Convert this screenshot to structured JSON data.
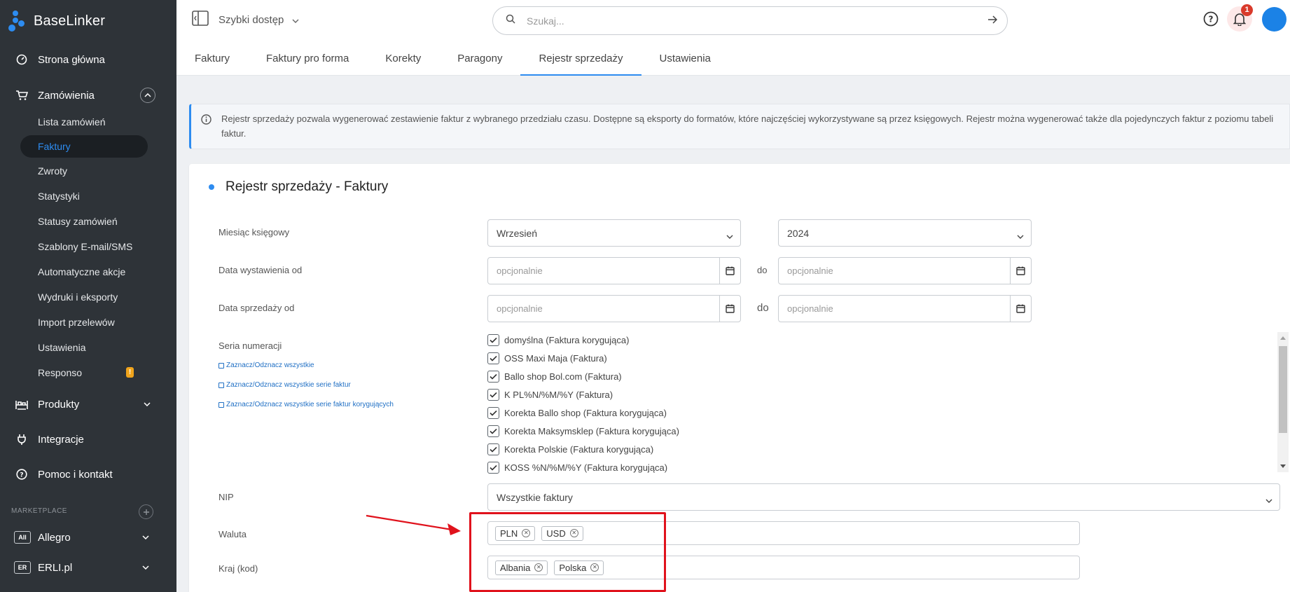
{
  "app": {
    "name": "BaseLinker"
  },
  "sidebar": {
    "home": "Strona główna",
    "orders": "Zamówienia",
    "order_items": [
      "Lista zamówień",
      "Faktury",
      "Zwroty",
      "Statystyki",
      "Statusy zamówień",
      "Szablony E-mail/SMS",
      "Automatyczne akcje",
      "Wydruki i eksporty",
      "Import przelewów",
      "Ustawienia",
      "Responso"
    ],
    "active_item": "Faktury",
    "responso_badge": "!",
    "products": "Produkty",
    "integrations": "Integracje",
    "help": "Pomoc i kontakt",
    "marketplace_label": "MARKETPLACE",
    "marketplaces": [
      {
        "logo": "All",
        "name": "Allegro"
      },
      {
        "logo": "ER",
        "name": "ERLI.pl"
      }
    ]
  },
  "topbar": {
    "quick_access": "Szybki dostęp",
    "search_placeholder": "Szukaj...",
    "notifications_count": "1",
    "accent": "#2d8cf0"
  },
  "tabs": [
    "Faktury",
    "Faktury pro forma",
    "Korekty",
    "Paragony",
    "Rejestr sprzedaży",
    "Ustawienia"
  ],
  "active_tab": "Rejestr sprzedaży",
  "info": {
    "text": "Rejestr sprzedaży pozwala wygenerować zestawienie faktur z wybranego przedziału czasu. Dostępne są eksporty do formatów, które najczęściej wykorzystywane są przez księgowych. Rejestr można wygenerować także dla pojedynczych faktur z poziomu tabeli faktur."
  },
  "form": {
    "title": "Rejestr sprzedaży - Faktury",
    "month_label": "Miesiąc księgowy",
    "month_value": "Wrzesień",
    "year_value": "2024",
    "issue_date_label": "Data wystawienia od",
    "sale_date_label": "Data sprzedaży od",
    "to_label": "do",
    "optional_placeholder": "opcjonalnie",
    "series_label": "Seria numeracji",
    "select_all": "Zaznacz/Odznacz wszystkie",
    "select_all_invoices": "Zaznacz/Odznacz wszystkie serie faktur",
    "select_all_corrections": "Zaznacz/Odznacz wszystkie serie faktur korygujących",
    "series": [
      "domyślna (Faktura korygująca)",
      "OSS Maxi Maja (Faktura)",
      "Ballo shop Bol.com (Faktura)",
      "K PL%N/%M/%Y (Faktura)",
      "Korekta Ballo shop (Faktura korygująca)",
      "Korekta Maksymsklep (Faktura korygująca)",
      "Korekta Polskie (Faktura korygująca)",
      "KOSS %N/%M/%Y (Faktura korygująca)"
    ],
    "nip_label": "NIP",
    "nip_value": "Wszystkie faktury",
    "currency_label": "Waluta",
    "currencies": [
      "PLN",
      "USD"
    ],
    "country_label": "Kraj (kod)",
    "countries": [
      "Albania",
      "Polska"
    ]
  },
  "annotation_color": "#e0121c"
}
